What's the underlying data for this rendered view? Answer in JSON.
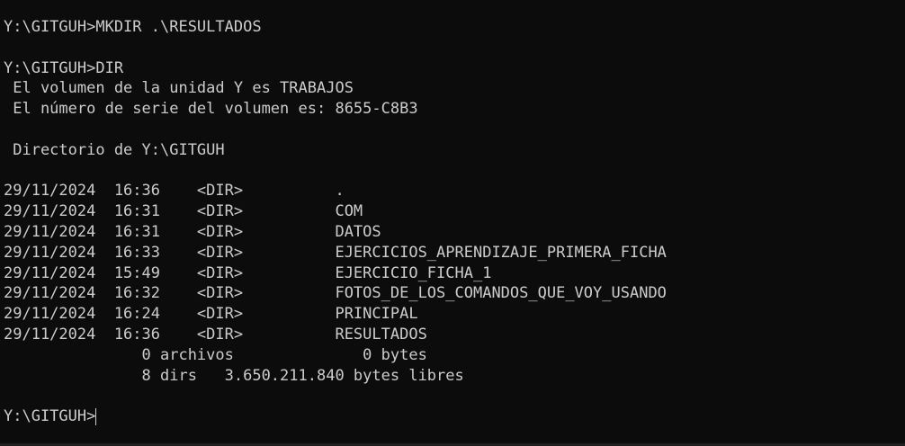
{
  "terminal": {
    "lines": [
      "Y:\\GITGUH>MKDIR .\\RESULTADOS",
      "",
      "Y:\\GITGUH>DIR",
      " El volumen de la unidad Y es TRABAJOS",
      " El número de serie del volumen es: 8655-C8B3",
      "",
      " Directorio de Y:\\GITGUH",
      "",
      "29/11/2024  16:36    <DIR>          .",
      "29/11/2024  16:31    <DIR>          COM",
      "29/11/2024  16:31    <DIR>          DATOS",
      "29/11/2024  16:33    <DIR>          EJERCICIOS_APRENDIZAJE_PRIMERA_FICHA",
      "29/11/2024  15:49    <DIR>          EJERCICIO_FICHA_1",
      "29/11/2024  16:32    <DIR>          FOTOS_DE_LOS_COMANDOS_QUE_VOY_USANDO",
      "29/11/2024  16:24    <DIR>          PRINCIPAL",
      "29/11/2024  16:36    <DIR>          RESULTADOS",
      "               0 archivos              0 bytes",
      "               8 dirs   3.650.211.840 bytes libres",
      ""
    ],
    "prompt": "Y:\\GITGUH>",
    "colors": {
      "background": "#0c0c0c",
      "text": "#cccccc"
    }
  }
}
